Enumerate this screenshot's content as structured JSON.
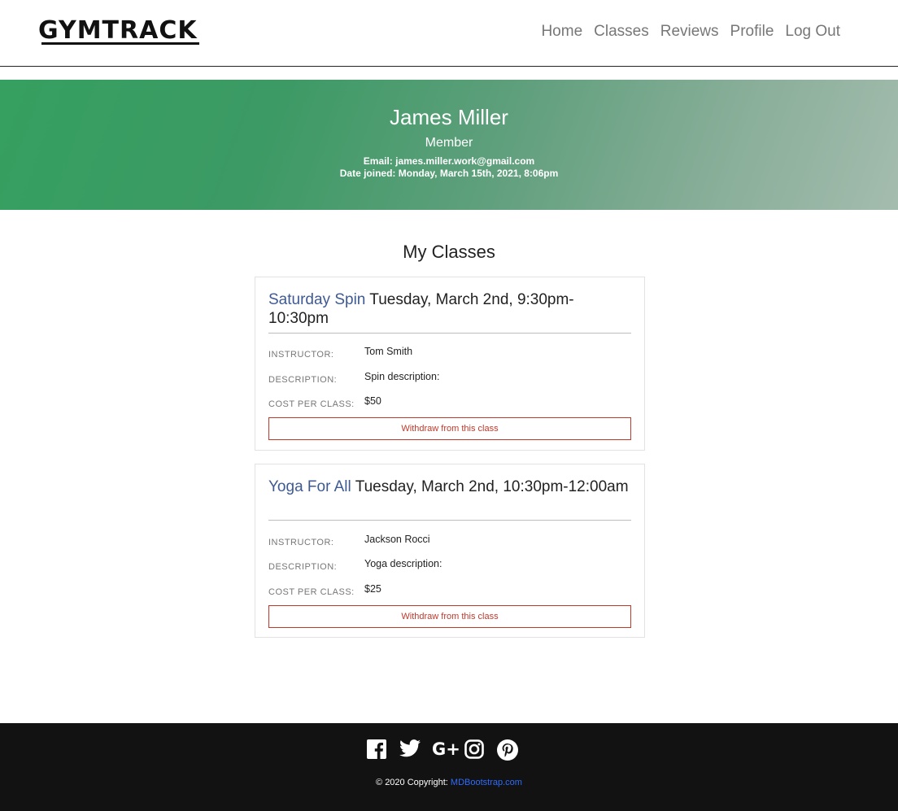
{
  "header": {
    "logo": "GYMTRACK",
    "nav": [
      "Home",
      "Classes",
      "Reviews",
      "Profile",
      "Log Out"
    ]
  },
  "profile": {
    "name": "James Miller",
    "role": "Member",
    "email_line": "Email: james.miller.work@gmail.com",
    "joined_line": "Date joined: Monday, March 15th, 2021, 8:06pm"
  },
  "main": {
    "title": "My Classes",
    "classes": [
      {
        "name": "Saturday Spin",
        "time": "Tuesday, March 2nd, 9:30pm-10:30pm",
        "instructor_label": "INSTRUCTOR:",
        "instructor": "Tom Smith",
        "description_label": "DESCRIPTION:",
        "description": "Spin description:",
        "cost_label": "COST PER CLASS:",
        "cost": "$50",
        "withdraw_label": "Withdraw from this class"
      },
      {
        "name": "Yoga For All",
        "time": "Tuesday, March 2nd, 10:30pm-12:00am",
        "instructor_label": "INSTRUCTOR:",
        "instructor": "Jackson Rocci",
        "description_label": "DESCRIPTION:",
        "description": "Yoga description:",
        "cost_label": "COST PER CLASS:",
        "cost": "$25",
        "withdraw_label": "Withdraw from this class"
      }
    ]
  },
  "footer": {
    "social_icons": [
      "facebook-icon",
      "twitter-icon",
      "google-plus-icon",
      "instagram-icon",
      "pinterest-icon"
    ],
    "copyright_prefix": "© 2020 Copyright: ",
    "copyright_link": "MDBootstrap.com"
  },
  "colors": {
    "class_name": "#3f5a93",
    "withdraw": "#c0392b",
    "footer_bg": "#121212",
    "link": "#2d6bff"
  }
}
